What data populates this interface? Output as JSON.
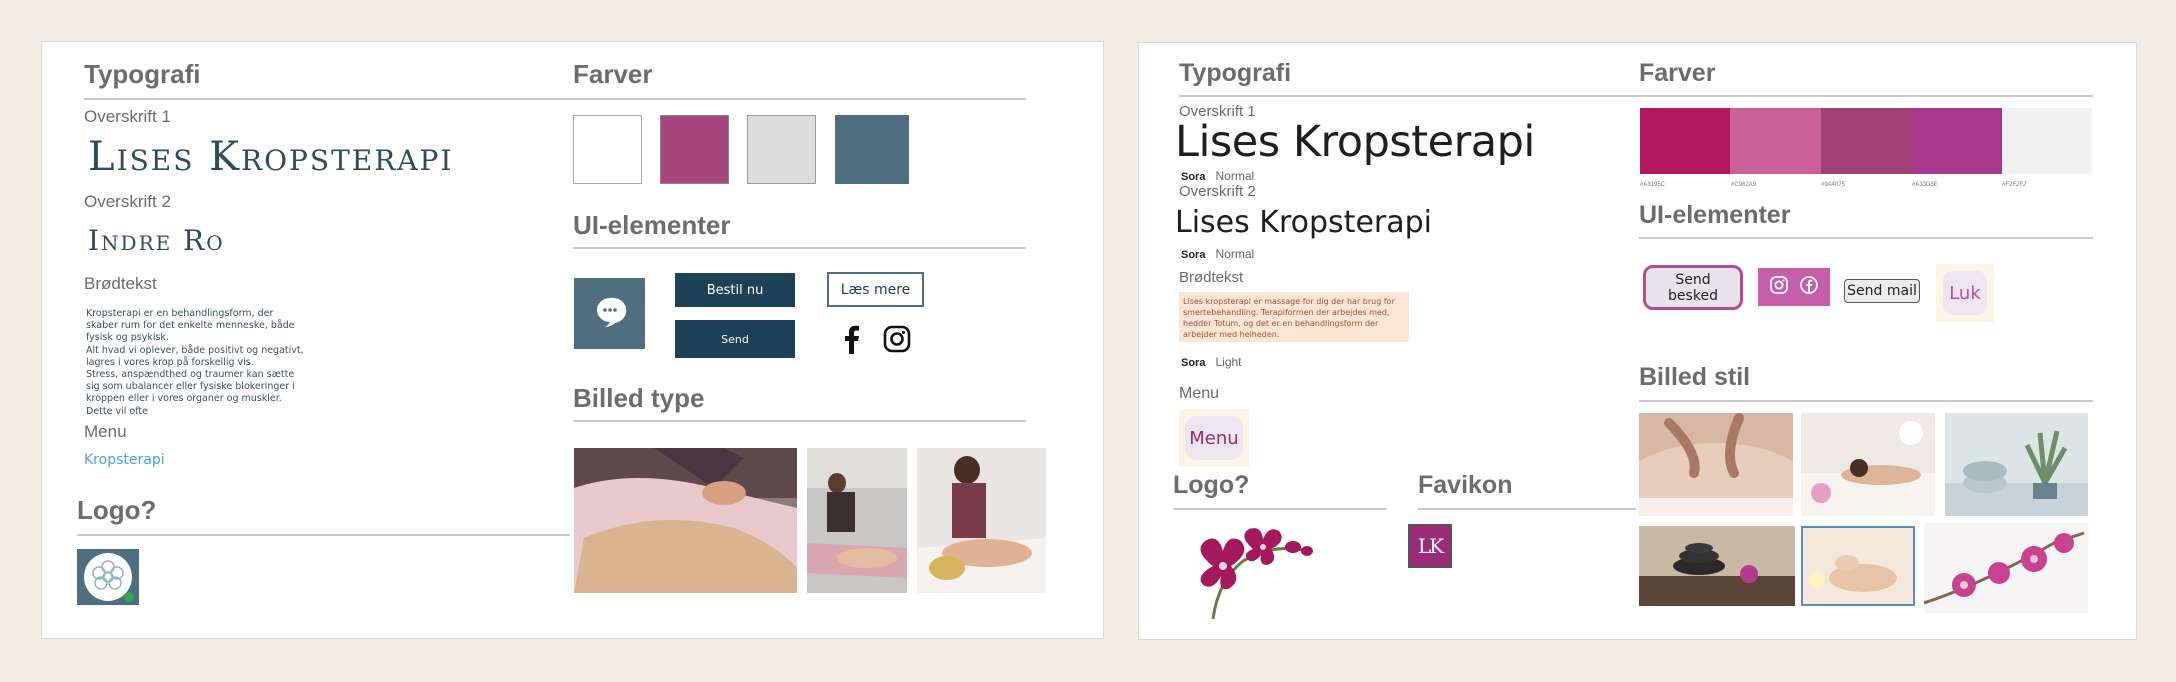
{
  "left": {
    "typografi": "Typografi",
    "overskrift1_label": "Overskrift 1",
    "overskrift1_sample": "Lises Kropsterapi",
    "overskrift2_label": "Overskrift 2",
    "overskrift2_sample": "Indre Ro",
    "broedtekst_label": "Brødtekst",
    "broedtekst_body": "Kropsterapi er en behandlingsform, der skaber rum for det enkelte menneske, både fysisk og psykisk.\nAlt hvad vi oplever, både positivt og negativt, lagres i vores krop på forskellig vis.\nStress, anspændthed og traumer kan sætte sig som ubalancer eller fysiske blokeringer i kroppen eller i vores organer og muskler. Dette vil ofte",
    "menu_label": "Menu",
    "menu_sample": "Kropsterapi",
    "logo_heading": "Logo?",
    "farver": "Farver",
    "colors": [
      "#ffffff",
      "#a8477e",
      "#dddddd",
      "#4f6e80"
    ],
    "ui_heading": "UI-elementer",
    "btn_bestil": "Bestil nu",
    "btn_send": "Send",
    "btn_laes": "Læs mere",
    "billed_heading": "Billed type",
    "icons": [
      "chat-icon",
      "facebook-icon",
      "instagram-icon"
    ]
  },
  "right": {
    "typografi": "Typografi",
    "overskrift1_label": "Overskrift 1",
    "overskrift1_sample": "Lises Kropsterapi",
    "font1_name": "Sora",
    "font1_weight": "Normal",
    "overskrift2_label": "Overskrift 2",
    "overskrift2_sample": "Lises Kropsterapi",
    "font2_name": "Sora",
    "font2_weight": "Normal",
    "broedtekst_label": "Brødtekst",
    "broedtekst_body": "Lises kropsterapi er massage for dig der har brug for smertebehandling. Terapiformen der arbejdes med, hedder Totum, og det er en behandlingsform der arbejder med helheden.",
    "font3_name": "Sora",
    "font3_weight": "Light",
    "menu_label": "Menu",
    "menu_button": "Menu",
    "logo_heading": "Logo?",
    "favikon_heading": "Favikon",
    "favicon_text": "LK",
    "farver": "Farver",
    "palette": [
      {
        "color": "#b0195f",
        "hex": "#A3195C"
      },
      {
        "color": "#c9609a",
        "hex": "#C962A9"
      },
      {
        "color": "#a04076",
        "hex": "#9A4075"
      },
      {
        "color": "#a8388c",
        "hex": "#A33D8E"
      },
      {
        "color": "#f0f0f0",
        "hex": "#F2F2F2"
      }
    ],
    "ui_heading": "UI-elementer",
    "btn_send_besked": "Send besked",
    "btn_send_mail": "Send mail",
    "btn_luk": "Luk",
    "billed_heading": "Billed stil"
  }
}
